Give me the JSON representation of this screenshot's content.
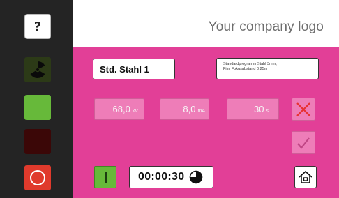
{
  "sidebar": {
    "help_label": "?",
    "indicators": [
      {
        "name": "radiation",
        "color": "#2c3a17",
        "icon": "radiation-icon"
      },
      {
        "name": "ready",
        "color": "#67b93a"
      },
      {
        "name": "warning",
        "color": "#3b0707"
      },
      {
        "name": "power",
        "color": "#e03a2c",
        "icon": "power-ring-icon"
      }
    ]
  },
  "header": {
    "logo_text": "Your company logo"
  },
  "program": {
    "name": "Std. Stahl 1",
    "description_line1": "Standardprogramm Stahl 3mm,",
    "description_line2": "Film Fokusabstand 0,25m"
  },
  "params": {
    "voltage": {
      "value": "68,0",
      "unit": "kV"
    },
    "current": {
      "value": "8,0",
      "unit": "mA"
    },
    "time": {
      "value": "30",
      "unit": "s"
    }
  },
  "timer": {
    "value": "00:00:30",
    "icon": "pie-clock-icon"
  },
  "colors": {
    "accent": "#e23f97",
    "field_disabled": "#ee7db8",
    "cancel_x": "#e83030",
    "ok_check": "#c04685",
    "start_green": "#67b93a"
  }
}
